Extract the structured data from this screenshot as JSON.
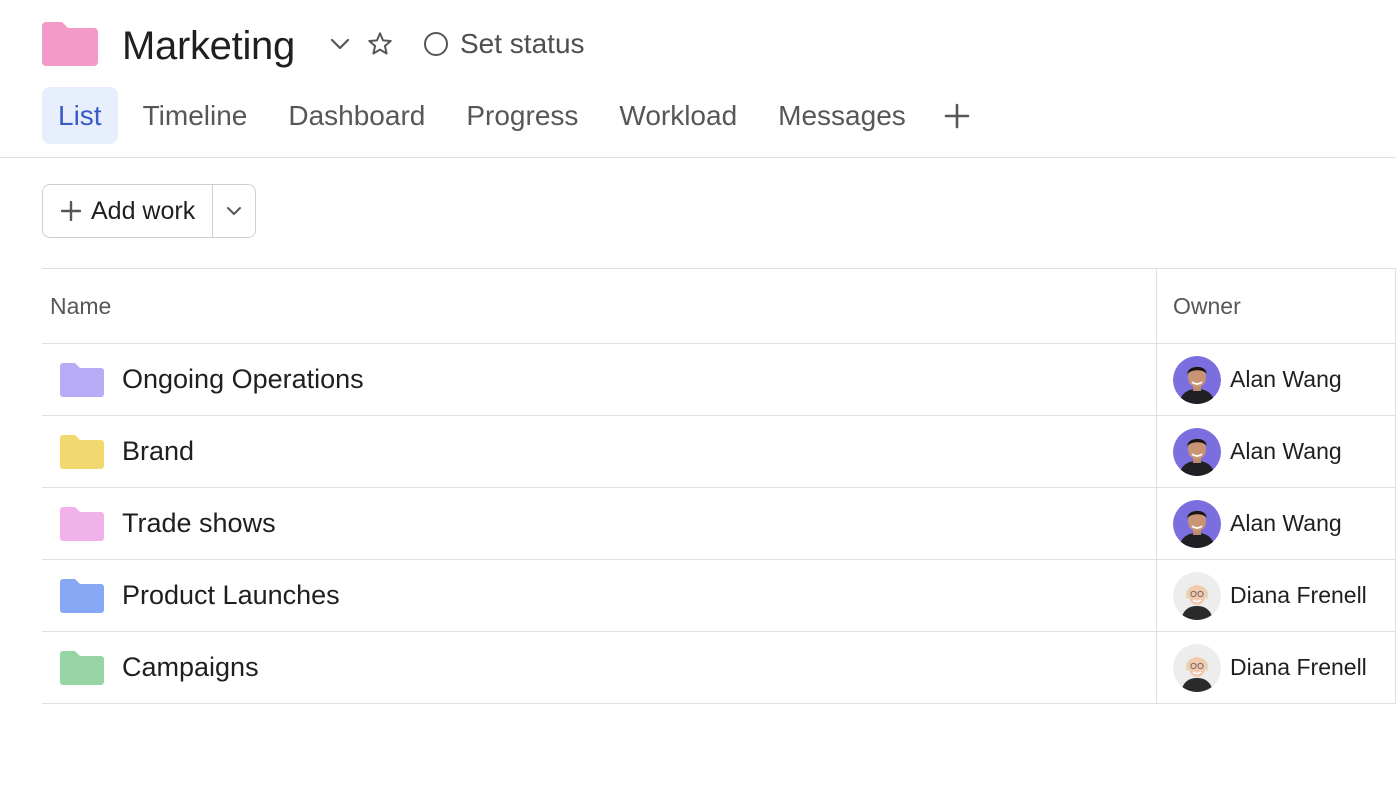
{
  "project": {
    "title": "Marketing",
    "icon": "folder-icon",
    "icon_color": "#f49ac9",
    "status_label": "Set status"
  },
  "tabs": [
    {
      "label": "List",
      "active": true
    },
    {
      "label": "Timeline"
    },
    {
      "label": "Dashboard"
    },
    {
      "label": "Progress"
    },
    {
      "label": "Workload"
    },
    {
      "label": "Messages"
    }
  ],
  "toolbar": {
    "add_work_label": "Add work"
  },
  "table": {
    "columns": [
      "Name",
      "Owner"
    ],
    "rows": [
      {
        "name": "Ongoing Operations",
        "folder_color": "#b8acf6",
        "owner": "Alan Wang",
        "avatar": "alan"
      },
      {
        "name": "Brand",
        "folder_color": "#f1d96f",
        "owner": "Alan Wang",
        "avatar": "alan"
      },
      {
        "name": "Trade shows",
        "folder_color": "#f0b2e8",
        "owner": "Alan Wang",
        "avatar": "alan"
      },
      {
        "name": "Product Launches",
        "folder_color": "#86a8f5",
        "owner": "Diana Frenell",
        "avatar": "diana"
      },
      {
        "name": "Campaigns",
        "folder_color": "#97d6a4",
        "owner": "Diana Frenell",
        "avatar": "diana"
      }
    ]
  },
  "colors": {
    "accent": "#3a5bc7",
    "active_tab_bg": "#e8effc"
  }
}
